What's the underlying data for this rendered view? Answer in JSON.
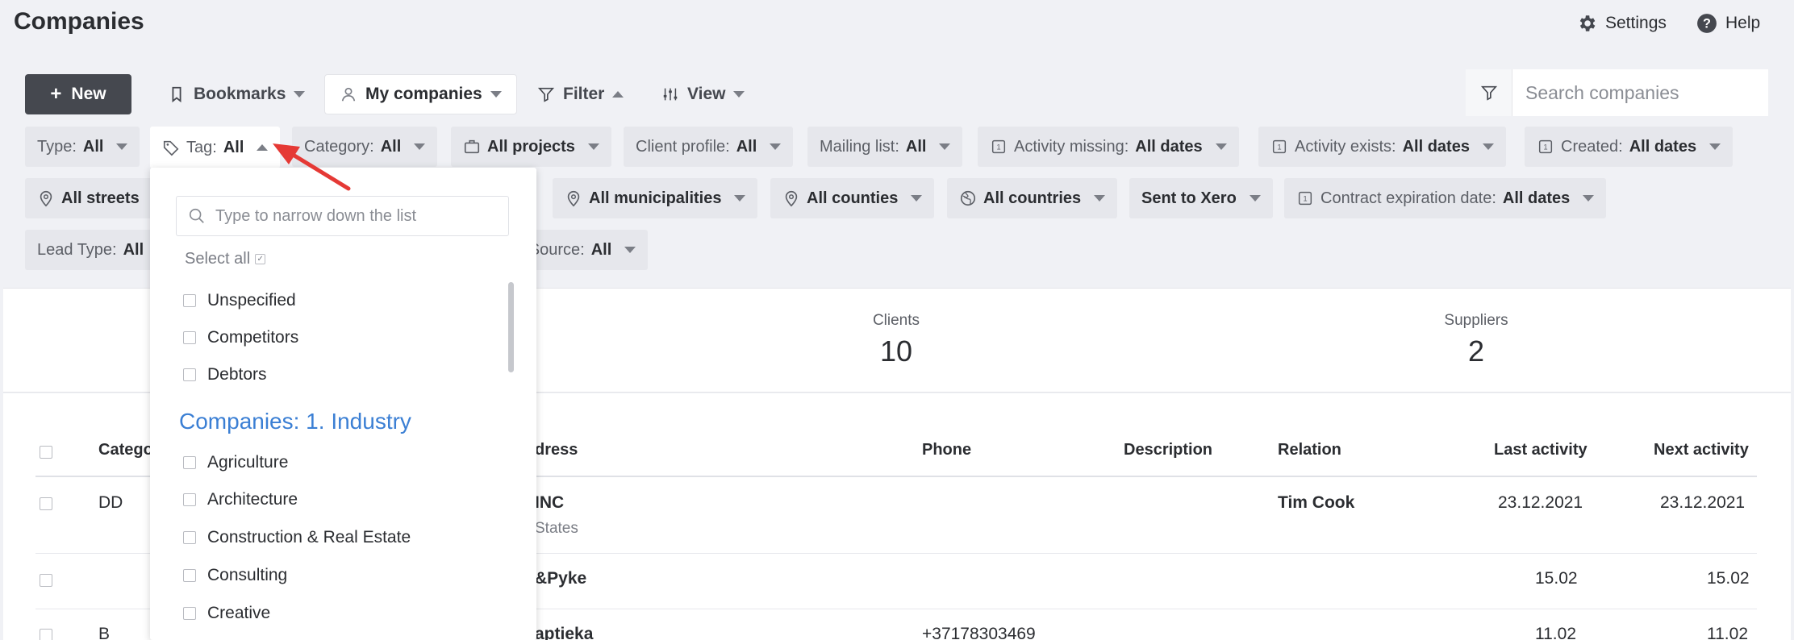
{
  "page": {
    "title": "Companies"
  },
  "top_links": {
    "settings": "Settings",
    "help": "Help"
  },
  "toolbar": {
    "new_label": "New",
    "bookmarks_label": "Bookmarks",
    "my_companies_label": "My companies",
    "filter_label": "Filter",
    "view_label": "View",
    "search_placeholder": "Search companies"
  },
  "filters": {
    "row1": [
      {
        "key": "Type:",
        "value": "All"
      },
      {
        "key": "Tag:",
        "value": "All"
      },
      {
        "key": "Category:",
        "value": "All"
      },
      {
        "key": "",
        "value": "All projects"
      },
      {
        "key": "Client profile:",
        "value": "All"
      },
      {
        "key": "Mailing list:",
        "value": "All"
      },
      {
        "key": "Activity missing:",
        "value": "All dates"
      },
      {
        "key": "Activity exists:",
        "value": "All dates"
      },
      {
        "key": "Created:",
        "value": "All dates"
      }
    ],
    "row2": [
      {
        "key": "",
        "value": "All streets"
      },
      {
        "key": "",
        "value": "All municipalities"
      },
      {
        "key": "",
        "value": "All counties"
      },
      {
        "key": "",
        "value": "All countries"
      },
      {
        "key": "",
        "value": "Sent to Xero"
      },
      {
        "key": "Contract expiration date:",
        "value": "All dates"
      }
    ],
    "row3": [
      {
        "key": "Lead Type:",
        "value": "All"
      },
      {
        "key": "ad Source:",
        "value": "All"
      }
    ]
  },
  "stats": [
    {
      "label": "Clients",
      "value": "10"
    },
    {
      "label": "Suppliers",
      "value": "2"
    }
  ],
  "table": {
    "headers": [
      "Catego",
      "dress",
      "Phone",
      "Description",
      "Relation",
      "Last activity",
      "Next activity"
    ],
    "rows": [
      {
        "category": "DD",
        "name": "INC",
        "sub": "States",
        "phone": "",
        "relation": "Tim Cook",
        "last": "23.12.2021",
        "next": "23.12.2021"
      },
      {
        "category": "",
        "name": "&Pyke",
        "sub": "",
        "phone": "",
        "relation": "",
        "last": "15.02",
        "next": "15.02"
      },
      {
        "category": "B",
        "name": "aptieka",
        "sub": "",
        "phone": "+37178303469",
        "relation": "",
        "last": "11.02",
        "next": "11.02"
      }
    ]
  },
  "tag_dropdown": {
    "search_placeholder": "Type to narrow down the list",
    "select_all": "Select all",
    "items": [
      "Unspecified",
      "Competitors",
      "Debtors"
    ],
    "group_title": "Companies: 1. Industry",
    "group_items": [
      "Agriculture",
      "Architecture",
      "Construction & Real Estate",
      "Consulting",
      "Creative"
    ]
  },
  "colors": {
    "accent": "#3b7fd4",
    "new_button": "#45484f",
    "arrow": "#e53935"
  }
}
